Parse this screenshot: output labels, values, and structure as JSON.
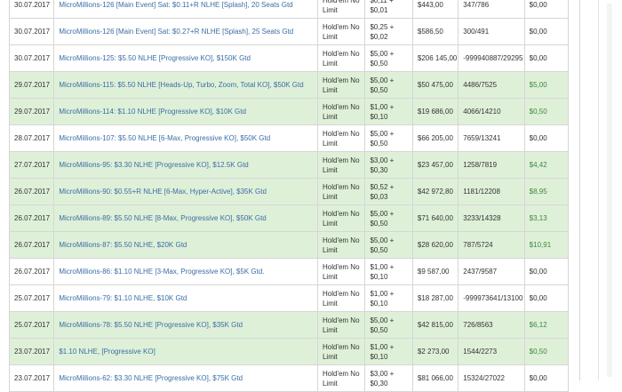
{
  "rows": [
    {
      "date": "30.07.2017",
      "name": "MicroMillions-126 [Main Event] Sat: $0.11+R NLHE [Splash], 20 Seats Gtd",
      "game": "Hold'em No Limit",
      "buyin": "$0,11 + $0,01",
      "prizepool": "$443,00",
      "place": "347/786",
      "winnings": "$0,00",
      "win": false
    },
    {
      "date": "30.07.2017",
      "name": "MicroMillions-126 [Main Event] Sat: $0.27+R NLHE [Splash], 25 Seats Gtd",
      "game": "Hold'em No Limit",
      "buyin": "$0,25 + $0,02",
      "prizepool": "$586,50",
      "place": "300/491",
      "winnings": "$0,00",
      "win": false
    },
    {
      "date": "30.07.2017",
      "name": "MicroMillions-125: $5.50 NLHE [Progressive KO], $150K Gtd",
      "game": "Hold'em No Limit",
      "buyin": "$5,00 + $0,50",
      "prizepool": "$206 145,00",
      "place": "-999940887/29295",
      "winnings": "$0,00",
      "win": false
    },
    {
      "date": "29.07.2017",
      "name": "MicroMillions-115: $5.50 NLHE [Heads-Up, Turbo, Zoom, Total KO], $50K Gtd",
      "game": "Hold'em No Limit",
      "buyin": "$5,00 + $0,50",
      "prizepool": "$50 475,00",
      "place": "4486/7525",
      "winnings": "$5,00",
      "win": true
    },
    {
      "date": "29.07.2017",
      "name": "MicroMillions-114: $1.10 NLHE [Progressive KO], $10K Gtd",
      "game": "Hold'em No Limit",
      "buyin": "$1,00 + $0,10",
      "prizepool": "$19 686,00",
      "place": "4066/14210",
      "winnings": "$0,50",
      "win": true
    },
    {
      "date": "28.07.2017",
      "name": "MicroMillions-107: $5.50 NLHE [6-Max, Progressive KO], $50K Gtd",
      "game": "Hold'em No Limit",
      "buyin": "$5,00 + $0,50",
      "prizepool": "$66 205,00",
      "place": "7659/13241",
      "winnings": "$0,00",
      "win": false
    },
    {
      "date": "27.07.2017",
      "name": "MicroMillions-95: $3.30 NLHE [Progressive KO], $12.5K Gtd",
      "game": "Hold'em No Limit",
      "buyin": "$3,00 + $0,30",
      "prizepool": "$23 457,00",
      "place": "1258/7819",
      "winnings": "$4,42",
      "win": true
    },
    {
      "date": "26.07.2017",
      "name": "MicroMillions-90: $0.55+R NLHE [6-Max, Hyper-Active], $35K Gtd",
      "game": "Hold'em No Limit",
      "buyin": "$0,52 + $0,03",
      "prizepool": "$42 972,80",
      "place": "1181/12208",
      "winnings": "$8,95",
      "win": true
    },
    {
      "date": "26.07.2017",
      "name": "MicroMillions-89: $5.50 NLHE [8-Max, Progressive KO], $50K Gtd",
      "game": "Hold'em No Limit",
      "buyin": "$5,00 + $0,50",
      "prizepool": "$71 640,00",
      "place": "3233/14328",
      "winnings": "$3,13",
      "win": true
    },
    {
      "date": "26.07.2017",
      "name": "MicroMillions-87: $5.50 NLHE, $20K Gtd",
      "game": "Hold'em No Limit",
      "buyin": "$5,00 + $0,50",
      "prizepool": "$28 620,00",
      "place": "787/5724",
      "winnings": "$10,91",
      "win": true
    },
    {
      "date": "26.07.2017",
      "name": "MicroMillions-86: $1.10 NLHE [3-Max, Progressive KO], $5K Gtd.",
      "game": "Hold'em No Limit",
      "buyin": "$1,00 + $0,10",
      "prizepool": "$9 587,00",
      "place": "2437/9587",
      "winnings": "$0,00",
      "win": false
    },
    {
      "date": "25.07.2017",
      "name": "MicroMillions-79: $1.10 NLHE, $10K Gtd",
      "game": "Hold'em No Limit",
      "buyin": "$1,00 + $0,10",
      "prizepool": "$18 287,00",
      "place": "-999973641/13100",
      "winnings": "$0,00",
      "win": false
    },
    {
      "date": "25.07.2017",
      "name": "MicroMillions-78: $5.50 NLHE [Progressive KO], $35K Gtd",
      "game": "Hold'em No Limit",
      "buyin": "$5,00 + $0,50",
      "prizepool": "$42 815,00",
      "place": "726/8563",
      "winnings": "$6,12",
      "win": true
    },
    {
      "date": "23.07.2017",
      "name": "$1.10 NLHE, [Progressive KO]",
      "game": "Hold'em No Limit",
      "buyin": "$1,00 + $0,10",
      "prizepool": "$2 273,00",
      "place": "1544/2273",
      "winnings": "$0,50",
      "win": true
    },
    {
      "date": "23.07.2017",
      "name": "MicroMillions-62: $3.30 NLHE [Progressive KO], $75K Gtd",
      "game": "Hold'em No Limit",
      "buyin": "$3,00 + $0,30",
      "prizepool": "$81 066,00",
      "place": "15324/27022",
      "winnings": "$0,00",
      "win": false
    }
  ],
  "colors": {
    "win_row_bg": "#dff0d8",
    "link": "#3a6ea5",
    "win_amount": "#3c8a3c",
    "border": "#d6d6d6"
  }
}
